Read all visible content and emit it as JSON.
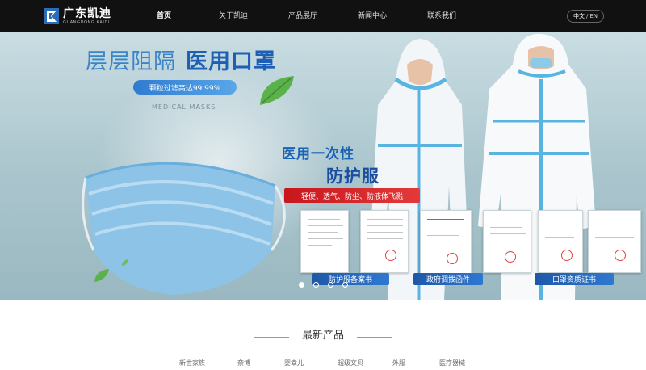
{
  "header": {
    "logo_cn": "广东凯迪",
    "logo_en": "GUANGDONG KAIDI",
    "nav": [
      "首页",
      "关于凯迪",
      "产品展厅",
      "新闻中心",
      "联系我们"
    ],
    "active_nav": 0,
    "lang_current": "中文",
    "lang_sep": "/",
    "lang_other": "EN"
  },
  "hero": {
    "slogan_a": "层层阻隔",
    "slogan_b": "医用口罩",
    "filter_text": "颗粒过滤高达99.99%",
    "mask_en": "MEDICAL MASKS",
    "title_line1": "医用一次性",
    "title_line2": "防护服",
    "features": "轻便、透气、防尘、防液体飞溅",
    "captions": [
      "防护服备案书",
      "政府调拨函件",
      "口罩资质证书"
    ],
    "slide_count": 4,
    "active_slide": 0
  },
  "products": {
    "title": "最新产品",
    "tabs": [
      "新世家族",
      "奈博",
      "婴幸儿",
      "超级文贝",
      "外服",
      "医疗器械"
    ]
  },
  "colors": {
    "topbar": "#111111",
    "accent_blue": "#1d5fb4",
    "accent_red": "#c8161d"
  }
}
